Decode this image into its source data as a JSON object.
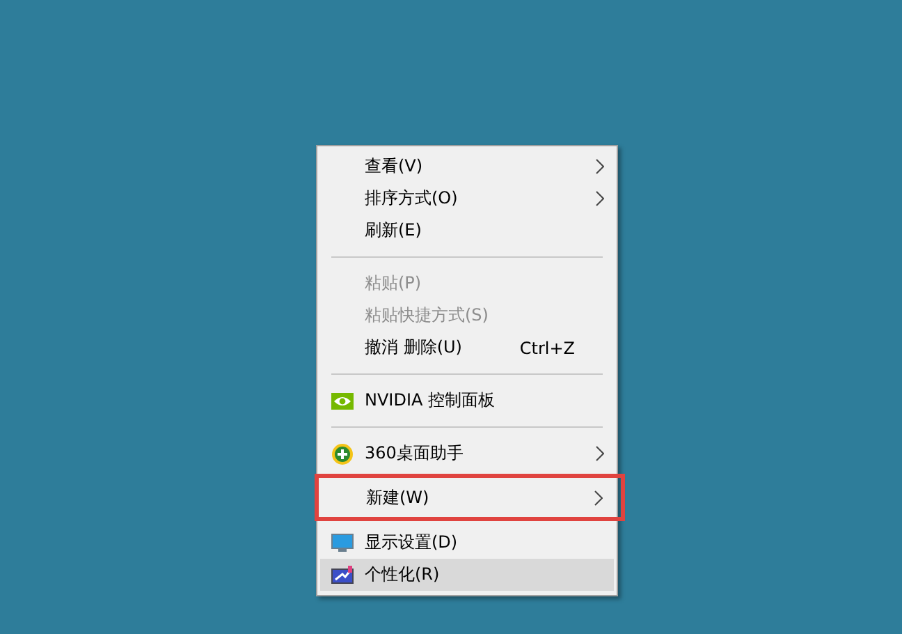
{
  "menu": {
    "items": [
      {
        "kind": "item",
        "label": "查看(V)",
        "submenu": true,
        "disabled": false,
        "selected": false
      },
      {
        "kind": "item",
        "label": "排序方式(O)",
        "submenu": true,
        "disabled": false,
        "selected": false
      },
      {
        "kind": "item",
        "label": "刷新(E)",
        "submenu": false,
        "disabled": false,
        "selected": false
      },
      {
        "kind": "separator"
      },
      {
        "kind": "item",
        "label": "粘贴(P)",
        "submenu": false,
        "disabled": true,
        "selected": false
      },
      {
        "kind": "item",
        "label": "粘贴快捷方式(S)",
        "submenu": false,
        "disabled": true,
        "selected": false
      },
      {
        "kind": "item",
        "label": "撤消 删除(U)",
        "shortcut": "Ctrl+Z",
        "submenu": false,
        "disabled": false,
        "selected": false
      },
      {
        "kind": "separator"
      },
      {
        "kind": "item",
        "label": "NVIDIA 控制面板",
        "submenu": false,
        "disabled": false,
        "selected": false
      },
      {
        "kind": "separator"
      },
      {
        "kind": "item",
        "label": "360桌面助手",
        "submenu": true,
        "disabled": false,
        "selected": false
      },
      {
        "kind": "item",
        "label": "新建(W)",
        "submenu": true,
        "disabled": false,
        "selected": false,
        "highlighted": true
      },
      {
        "kind": "item",
        "label": "显示设置(D)",
        "submenu": false,
        "disabled": false,
        "selected": false
      },
      {
        "kind": "item",
        "label": "个性化(R)",
        "submenu": false,
        "disabled": false,
        "selected": true
      }
    ]
  }
}
